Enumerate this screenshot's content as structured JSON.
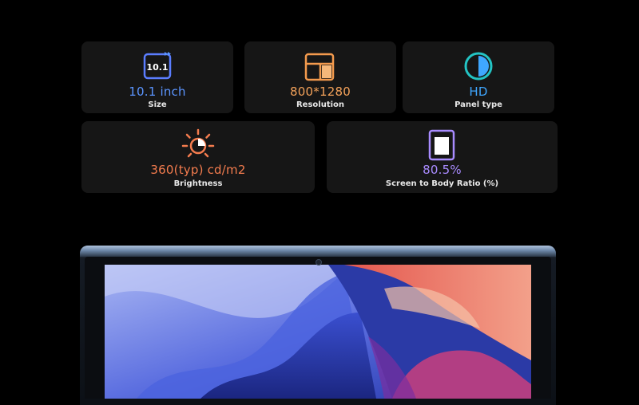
{
  "specs": [
    {
      "icon": "screen-size-icon",
      "value": "10.1 inch",
      "label": "Size",
      "icon_text": "10.1",
      "color": "#5b95ff"
    },
    {
      "icon": "resolution-icon",
      "value": "800*1280",
      "label": "Resolution",
      "color": "#f4a25a"
    },
    {
      "icon": "contrast-icon",
      "value": "HD",
      "label": "Panel type",
      "color": "#3fa7ff"
    },
    {
      "icon": "brightness-icon",
      "value": "360(typ) cd/m2",
      "label": "Brightness",
      "color": "#f47c4e"
    },
    {
      "icon": "screen-ratio-icon",
      "value": "80.5%",
      "label": "Screen to Body Ratio (%)",
      "color": "#a98bff"
    }
  ],
  "background_color": "#000000",
  "card_color": "#161616"
}
